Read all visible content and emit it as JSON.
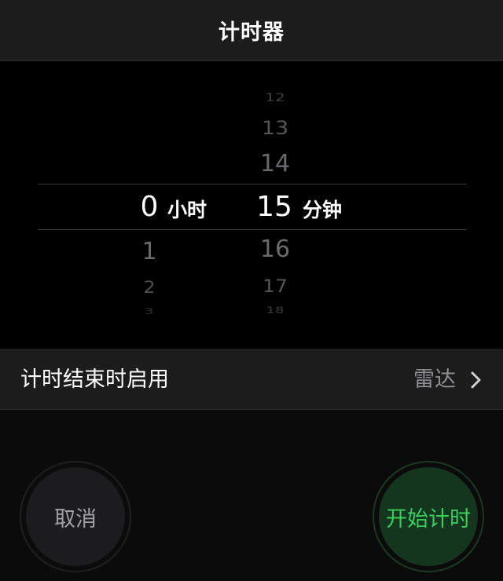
{
  "nav": {
    "title": "计时器"
  },
  "picker": {
    "hours": {
      "selected": "0",
      "unit": "小时",
      "below": [
        "1",
        "2",
        "3"
      ]
    },
    "minutes": {
      "above": [
        "12",
        "13",
        "14"
      ],
      "selected": "15",
      "unit": "分钟",
      "below": [
        "16",
        "17",
        "18"
      ]
    }
  },
  "setting": {
    "label": "计时结束时启用",
    "value": "雷达"
  },
  "buttons": {
    "cancel": "取消",
    "start": "开始计时"
  },
  "colors": {
    "start_text": "#38d05c",
    "start_bg": "#15361e",
    "cancel_bg": "#1c1c1e"
  },
  "icons": {
    "chevron": "chevron-right-icon"
  }
}
